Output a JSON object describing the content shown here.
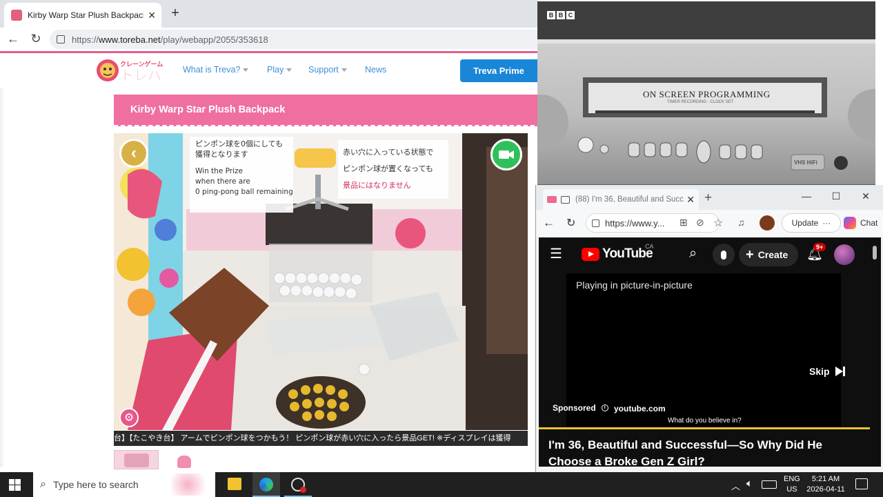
{
  "left_browser": {
    "tab_title": "Kirby Warp Star Plush Backpack | C",
    "url_prefix": "https://",
    "url_host": "www.toreba.net",
    "url_path": "/play/webapp/2055/353618"
  },
  "site": {
    "logo_text": "クレーンゲーム トレバ",
    "nav": [
      "What is Treva?",
      "Play",
      "Support",
      "News"
    ],
    "prime_button": "Treva Prime",
    "product_title": "Kirby Warp Star Plush Backpack",
    "feed_text": {
      "sign_left_1": "ピンポン球を0個にしても",
      "sign_left_2": "獲得となります",
      "sign_en_1": "Win the Prize",
      "sign_en_2": "when there are",
      "sign_en_3": "0 ping-pong ball remaining",
      "sign_right_1": "赤い穴に入っている状態で",
      "sign_right_2": "ピンポン球が置くなっても",
      "sign_right_3": "景品にはなりません"
    },
    "ticker": "台】【たこやき台】 アームでピンポン球をつかもう！ ピンポン球が赤い穴に入ったら景品GET! ※ディスプレイは獲得"
  },
  "bbc_pip": {
    "logo_letters": [
      "B",
      "B",
      "C"
    ],
    "panel_text": "ON SCREEN PROGRAMMING",
    "panel_subtext": "TIMER RECORDING · CLOCK SET",
    "badge": "VHS HiFi"
  },
  "right_browser": {
    "tab_title": "(88) I'm 36, Beautiful and Succ",
    "url_text": "https://www.y...",
    "update_label": "Update",
    "chat_label": "Chat"
  },
  "youtube": {
    "logo_text": "YouTube",
    "country": "CA",
    "create_label": "Create",
    "notification_badge": "9+",
    "pip_status": "Playing in picture-in-picture",
    "skip_label": "Skip",
    "sponsored_label": "Sponsored",
    "sponsor_domain": "youtube.com",
    "ad_caption": "What do you believe in?",
    "video_title": "I'm 36, Beautiful and Successful—So Why Did He Choose a Broke Gen Z Girl?",
    "accent_color": "#f2c230"
  },
  "taskbar": {
    "search_placeholder": "Type here to search",
    "lang_top": "ENG",
    "lang_bottom": "US",
    "time": "5:21 AM",
    "date": "2026-04-11"
  }
}
